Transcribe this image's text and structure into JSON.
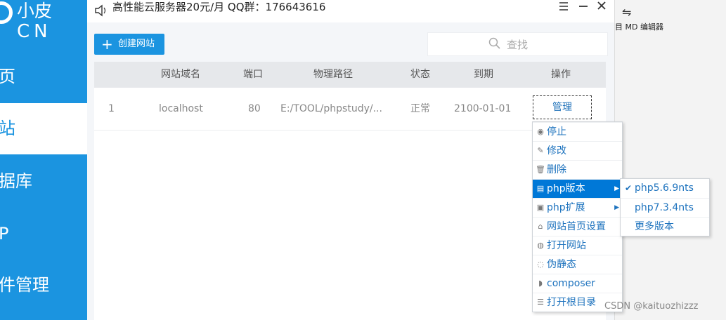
{
  "sidebar": {
    "logo_name": "小皮",
    "logo_sub": "CN",
    "items": [
      {
        "label": "页"
      },
      {
        "label": "站"
      },
      {
        "label": "据库"
      },
      {
        "label": "P"
      },
      {
        "label": "件管理"
      }
    ],
    "active_index": 1,
    "color": "#1b94e0"
  },
  "titlebar": {
    "ad_text": "高性能云服务器20元/月 QQ群：176643616",
    "menu_icon": "hamburger-icon",
    "minimize_icon": "minimize-icon",
    "close_icon": "close-icon"
  },
  "toolbar": {
    "create_label": "创建网站",
    "search_placeholder": "查找"
  },
  "table": {
    "columns": [
      "网站域名",
      "端口",
      "物理路径",
      "状态",
      "到期",
      "操作"
    ],
    "rows": [
      {
        "index": "1",
        "domain": "localhost",
        "port": "80",
        "path": "E:/TOOL/phpstudy/...",
        "status": "正常",
        "expiry": "2100-01-01",
        "action": "管理"
      }
    ]
  },
  "context_menu": {
    "items": [
      {
        "icon": "stop-icon",
        "glyph": "◉",
        "label": "停止"
      },
      {
        "icon": "edit-icon",
        "glyph": "✎",
        "label": "修改"
      },
      {
        "icon": "trash-icon",
        "glyph": "🗑",
        "label": "删除"
      },
      {
        "icon": "php-icon",
        "glyph": "▤",
        "label": "php版本",
        "submenu": true
      },
      {
        "icon": "extension-icon",
        "glyph": "▣",
        "label": "php扩展",
        "submenu": true
      },
      {
        "icon": "home-icon",
        "glyph": "⌂",
        "label": "网站首页设置"
      },
      {
        "icon": "globe-icon",
        "glyph": "◍",
        "label": "打开网站"
      },
      {
        "icon": "rewrite-icon",
        "glyph": "◌",
        "label": "伪静态"
      },
      {
        "icon": "composer-icon",
        "glyph": "◗",
        "label": "composer"
      },
      {
        "icon": "list-icon",
        "glyph": "☰",
        "label": "打开根目录"
      }
    ],
    "highlighted": "php版本"
  },
  "php_submenu": {
    "items": [
      {
        "label": "php5.6.9nts",
        "checked": true
      },
      {
        "label": "php7.3.4nts",
        "checked": false
      },
      {
        "label": "更多版本",
        "checked": false
      }
    ]
  },
  "right_pane": {
    "label": "目 MD 编辑器"
  },
  "watermark": "CSDN @kaituozhizzz"
}
